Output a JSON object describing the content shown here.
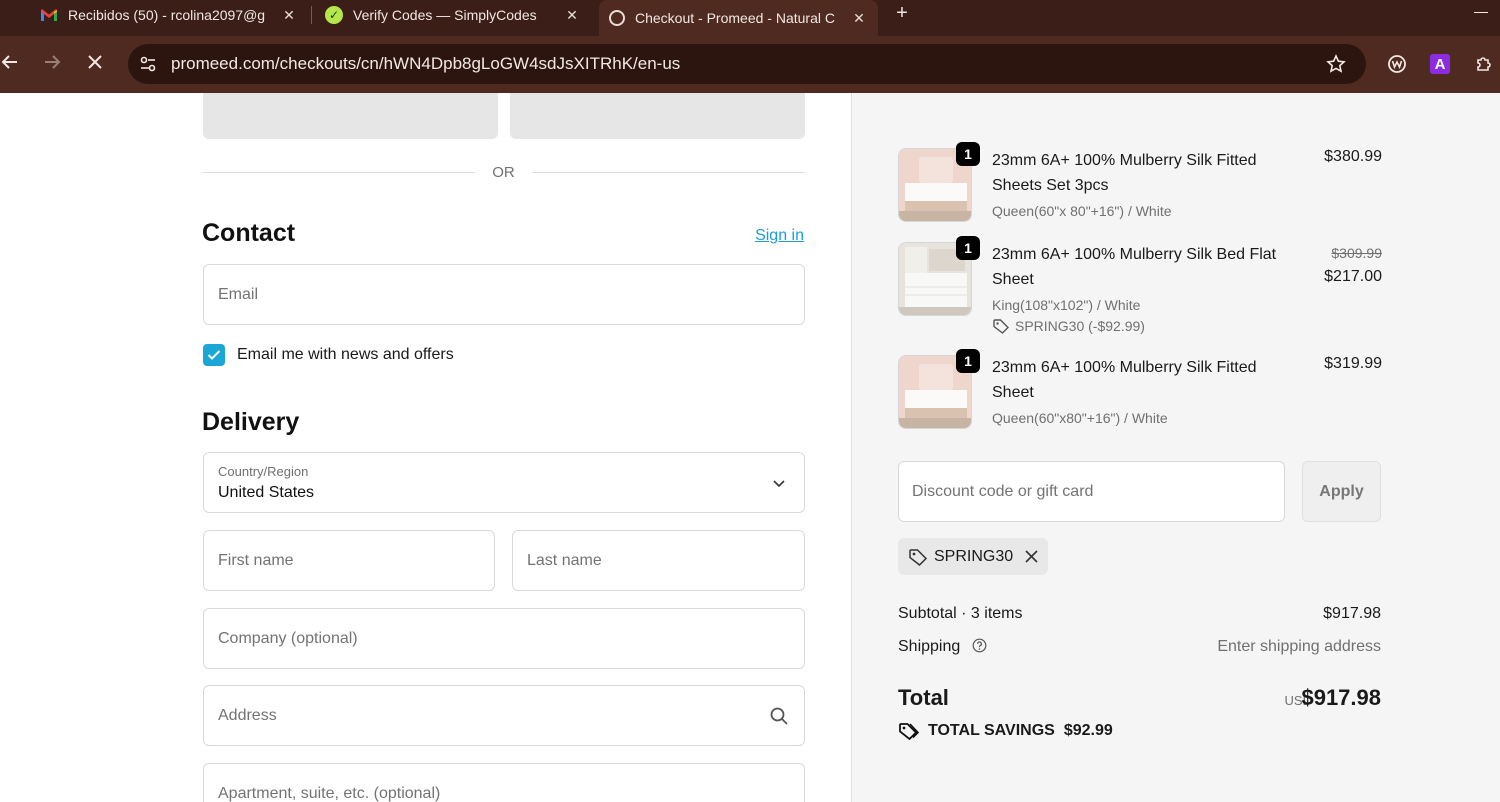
{
  "browser": {
    "tabs": [
      {
        "title": "Recibidos (50) - rcolina2097@g",
        "icon": "gmail-icon",
        "active": false
      },
      {
        "title": "Verify Codes — SimplyCodes",
        "icon": "simplycodes-icon",
        "active": false
      },
      {
        "title": "Checkout - Promeed - Natural C",
        "icon": "promeed-icon",
        "active": true
      }
    ],
    "new_tab": "+",
    "url": "promeed.com/checkouts/cn/hWN4Dpb8gLoGW4sdJsXITRhK/en-us",
    "extension_a": "A"
  },
  "checkout": {
    "or": "OR",
    "contact": {
      "heading": "Contact",
      "sign_in": "Sign in",
      "email_placeholder": "Email",
      "newsletter_label": "Email me with news and offers",
      "newsletter_checked": true
    },
    "delivery": {
      "heading": "Delivery",
      "country_label": "Country/Region",
      "country_value": "United States",
      "first_name": "First name",
      "last_name": "Last name",
      "company": "Company (optional)",
      "address": "Address",
      "apartment": "Apartment, suite, etc. (optional)"
    }
  },
  "summary": {
    "items": [
      {
        "qty": "1",
        "name": "23mm 6A+ 100% Mulberry Silk Fitted Sheets Set 3pcs",
        "variant": "Queen(60\"x 80\"+16\") / White",
        "price": "$380.99"
      },
      {
        "qty": "1",
        "name": "23mm 6A+ 100% Mulberry Silk Bed Flat Sheet",
        "variant": "King(108\"x102\") / White",
        "discount": "SPRING30 (-$92.99)",
        "original_price": "$309.99",
        "price": "$217.00"
      },
      {
        "qty": "1",
        "name": "23mm 6A+ 100% Mulberry Silk Fitted Sheet",
        "variant": "Queen(60\"x80\"+16\") / White",
        "price": "$319.99"
      }
    ],
    "discount_placeholder": "Discount code or gift card",
    "apply_label": "Apply",
    "applied_code": "SPRING30",
    "subtotal_label": "Subtotal · 3 items",
    "subtotal_value": "$917.98",
    "shipping_label": "Shipping",
    "shipping_value": "Enter shipping address",
    "total_label": "Total",
    "currency": "USD",
    "total_value": "$917.98",
    "savings_label": "TOTAL SAVINGS",
    "savings_value": "$92.99"
  }
}
